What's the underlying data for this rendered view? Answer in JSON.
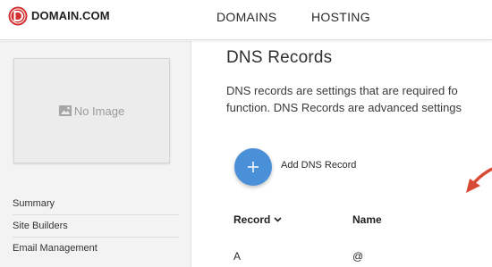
{
  "header": {
    "brand_name": "DOMAIN.COM",
    "brand_color": "#d32f2f",
    "logo_icon": "domain-logo-icon",
    "nav": [
      {
        "label": "DOMAINS"
      },
      {
        "label": "HOSTING"
      }
    ]
  },
  "sidebar": {
    "thumbnail": {
      "icon": "image-icon",
      "text": "No Image"
    },
    "items": [
      {
        "label": "Summary"
      },
      {
        "label": "Site Builders"
      },
      {
        "label": "Email Management"
      }
    ]
  },
  "main": {
    "title": "DNS Records",
    "description_line1": "DNS records are settings that are required fo",
    "description_line2": "function. DNS Records are advanced settings",
    "add_button": {
      "icon": "plus-icon",
      "label": "Add DNS Record",
      "color": "#4a90d9"
    },
    "annotation": {
      "icon": "arrow-annotation",
      "color": "#d94a35"
    },
    "table": {
      "columns": [
        {
          "label": "Record",
          "sort_icon": "chevron-down-icon"
        },
        {
          "label": "Name"
        }
      ],
      "rows": [
        {
          "record": "A",
          "name": "@"
        }
      ]
    }
  }
}
